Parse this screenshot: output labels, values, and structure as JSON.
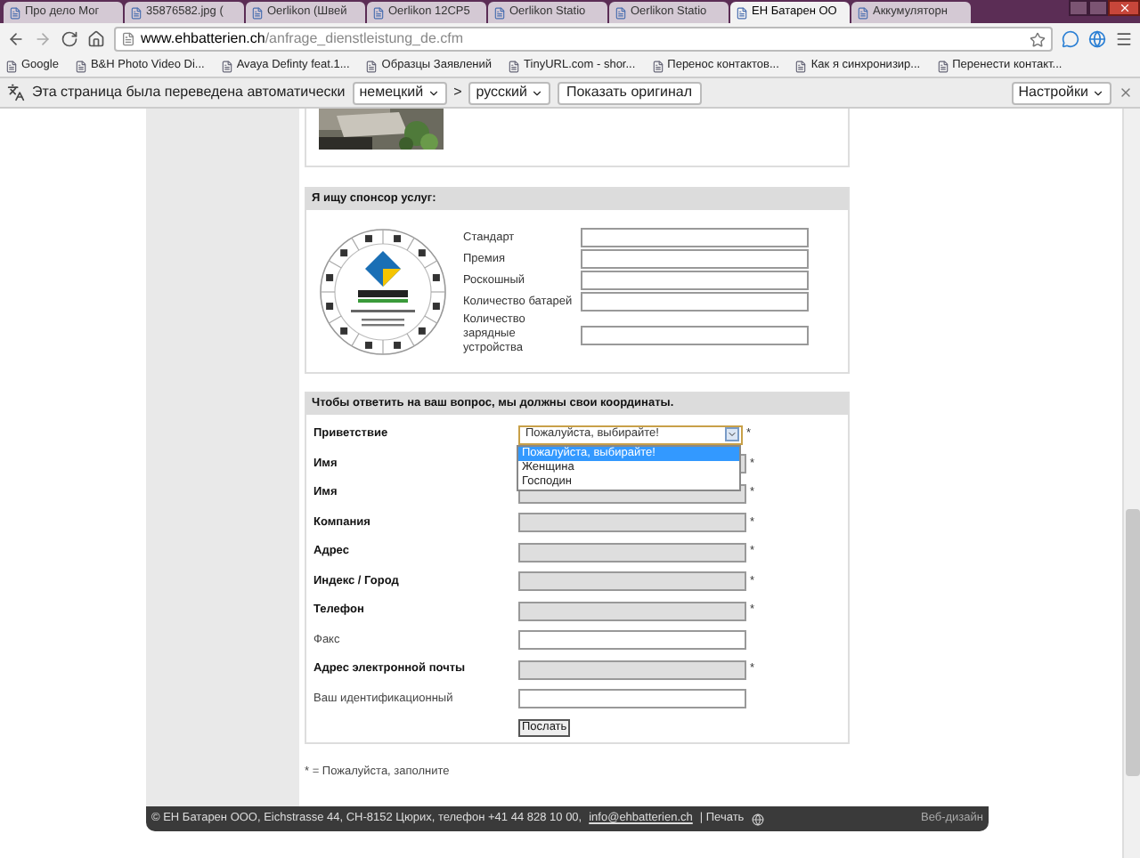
{
  "browser": {
    "tabs": [
      {
        "title": "Про дело Мог",
        "selected": false
      },
      {
        "title": "35876582.jpg (",
        "selected": false
      },
      {
        "title": "Oerlikon (Швей",
        "selected": false
      },
      {
        "title": "Oerlikon 12CP5",
        "selected": false
      },
      {
        "title": "Oerlikon Statio",
        "selected": false
      },
      {
        "title": "Oerlikon Statio",
        "selected": false
      },
      {
        "title": "ЕН Батарен ОО",
        "selected": true
      },
      {
        "title": "Аккумуляторн",
        "selected": false
      }
    ],
    "address": {
      "host": "www.ehbatterien.ch",
      "path": "/anfrage_dienstleistung_de.cfm"
    },
    "bookmarks": [
      "Google",
      "B&H Photo Video Di...",
      "Avaya Definty feat.1...",
      "Образцы Заявлений",
      "TinyURL.com - shor...",
      "Перенос контактов...",
      "Как я синхронизир...",
      "Перенести контакт..."
    ]
  },
  "translate_bar": {
    "message": "Эта страница была переведена автоматически",
    "from": "немецкий",
    "separator": ">",
    "to": "русский",
    "show_original": "Показать оригинал",
    "settings": "Настройки"
  },
  "page": {
    "service_section": {
      "title": "Я ищу спонсор услуг:",
      "fields": [
        "Стандарт",
        "Премия",
        "Роскошный",
        "Количество батарей",
        "Количество зарядные устройства"
      ]
    },
    "contact_section": {
      "title": "Чтобы ответить на ваш вопрос, мы должны свои координаты.",
      "salutation": {
        "label": "Приветствие",
        "value": "Пожалуйста, выбирайте!",
        "required": true,
        "options": [
          {
            "label": "Пожалуйста, выбирайте!",
            "selected": true
          },
          {
            "label": "Женщина",
            "selected": false
          },
          {
            "label": "Господин",
            "selected": false
          }
        ]
      },
      "required_mark": "*",
      "fields": [
        {
          "label": "Имя",
          "required": true
        },
        {
          "label": "Имя",
          "required": true
        },
        {
          "label": "Компания",
          "required": true
        },
        {
          "label": "Адрес",
          "required": true
        },
        {
          "label": "Индекс / Город",
          "required": true
        },
        {
          "label": "Телефон",
          "required": true
        },
        {
          "label": "Факс",
          "required": false
        },
        {
          "label": "Адрес электронной почты",
          "required": true
        },
        {
          "label": "Ваш идентификационный",
          "required": false
        }
      ],
      "submit": "Послать"
    },
    "required_note": "* = Пожалуйста, заполните",
    "footer": {
      "address": "© ЕН Батарен ООО, Eichstrasse 44, CH-8152 Цюрих, телефон +41 44 828 10 00,",
      "email": "info@ehbatterien.ch",
      "print": "| Печать",
      "credit": "Веб-дизайн"
    }
  }
}
